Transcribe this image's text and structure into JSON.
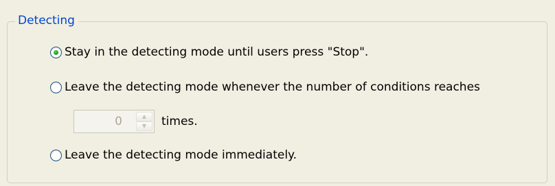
{
  "group": {
    "title": "Detecting"
  },
  "options": [
    {
      "label": "Stay in the detecting mode until users press \"Stop\".",
      "selected": true
    },
    {
      "label": "Leave the detecting mode whenever the number of conditions reaches",
      "selected": false
    },
    {
      "label": "Leave the detecting mode immediately.",
      "selected": false
    }
  ],
  "condition_count": {
    "value": "0",
    "unit_label": "times.",
    "enabled": false
  },
  "icons": {
    "spin_up": "chevron-up-icon",
    "spin_down": "chevron-down-icon"
  },
  "colors": {
    "group_title": "#0046d5",
    "radio_selected": "#21a121",
    "disabled_text": "#aca899"
  }
}
